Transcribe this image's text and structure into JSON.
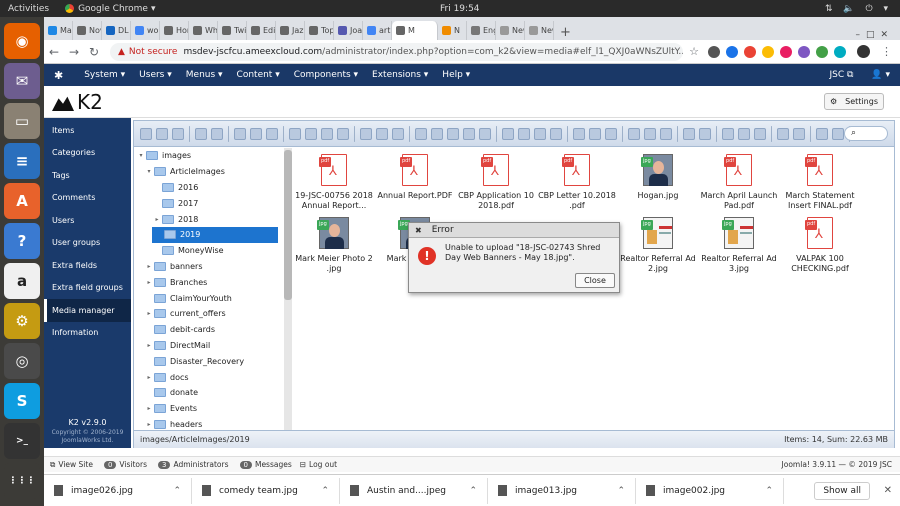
{
  "system": {
    "activities": "Activities",
    "app_name": "Google Chrome",
    "clock": "Fri 19:54"
  },
  "dock": [
    {
      "name": "firefox",
      "glyph": "◉",
      "color": "#e66000"
    },
    {
      "name": "mail",
      "glyph": "✉",
      "color": "#6d5d8f"
    },
    {
      "name": "files",
      "glyph": "▭",
      "color": "#8a8173"
    },
    {
      "name": "writer",
      "glyph": "≡",
      "color": "#2a6fbd"
    },
    {
      "name": "software",
      "glyph": "A",
      "color": "#e8622b"
    },
    {
      "name": "help",
      "glyph": "?",
      "color": "#3a7ad1"
    },
    {
      "name": "amazon",
      "glyph": "a",
      "color": "#f0f0f0"
    },
    {
      "name": "settings",
      "glyph": "⚙",
      "color": "#c59b12"
    },
    {
      "name": "chrome",
      "glyph": "◎",
      "color": "#4a4a4a"
    },
    {
      "name": "skype",
      "glyph": "S",
      "color": "#0e9de0"
    },
    {
      "name": "terminal",
      "glyph": ">_",
      "color": "#333333"
    },
    {
      "name": "apps",
      "glyph": "⋮⋮⋮",
      "color": "#3c3b37"
    }
  ],
  "tabs": [
    {
      "label": "Mai",
      "color": "#1e88e5"
    },
    {
      "label": "Nov",
      "color": "#666666"
    },
    {
      "label": "DL",
      "color": "#1565c0"
    },
    {
      "label": "wor",
      "color": "#4285f4"
    },
    {
      "label": "Hor",
      "color": "#666666"
    },
    {
      "label": "Whe",
      "color": "#666666"
    },
    {
      "label": "Twi",
      "color": "#666666"
    },
    {
      "label": "Edi",
      "color": "#666666"
    },
    {
      "label": "Jaz",
      "color": "#666666"
    },
    {
      "label": "Top",
      "color": "#666666"
    },
    {
      "label": "Joa",
      "color": "#5558af"
    },
    {
      "label": "arti",
      "color": "#4285f4"
    },
    {
      "label": "M",
      "color": "#666666"
    },
    {
      "label": "N",
      "color": "#f08c00"
    },
    {
      "label": "Eng",
      "color": "#777777"
    },
    {
      "label": "New Ta",
      "color": "#999999"
    },
    {
      "label": "New Ta",
      "color": "#999999"
    }
  ],
  "browser": {
    "not_secure": "Not secure",
    "url_host": "msdev-jscfcu.ameexcloud.com",
    "url_path": "/administrator/index.php?option=com_k2&view=media#elf_l1_QXJ0aWNsZUltY..."
  },
  "joomla_menu": [
    "System ▾",
    "Users ▾",
    "Menus ▾",
    "Content ▾",
    "Components ▾",
    "Extensions ▾",
    "Help ▾"
  ],
  "joomla_right": {
    "site": "JSC ⧉",
    "user": "👤 ▾"
  },
  "k2": {
    "logo": "K2",
    "settings": "Settings"
  },
  "sidebar": {
    "items": [
      "Items",
      "Categories",
      "Tags",
      "Comments",
      "Users",
      "User groups",
      "Extra fields",
      "Extra field groups",
      "Media manager",
      "Information"
    ],
    "active_index": 8,
    "version": "K2 v2.9.0",
    "copyright": "Copyright © 2006-2019",
    "company": "JoomlaWorks Ltd."
  },
  "tree": [
    {
      "label": "images",
      "indent": 0,
      "arrow": "▾"
    },
    {
      "label": "ArticleImages",
      "indent": 1,
      "arrow": "▾"
    },
    {
      "label": "2016",
      "indent": 2,
      "arrow": ""
    },
    {
      "label": "2017",
      "indent": 2,
      "arrow": ""
    },
    {
      "label": "2018",
      "indent": 2,
      "arrow": "▸"
    },
    {
      "label": "2019",
      "indent": 2,
      "arrow": "",
      "selected": true
    },
    {
      "label": "MoneyWise",
      "indent": 2,
      "arrow": ""
    },
    {
      "label": "banners",
      "indent": 1,
      "arrow": "▸"
    },
    {
      "label": "Branches",
      "indent": 1,
      "arrow": "▸"
    },
    {
      "label": "ClaimYourYouth",
      "indent": 1,
      "arrow": ""
    },
    {
      "label": "current_offers",
      "indent": 1,
      "arrow": "▸"
    },
    {
      "label": "debit-cards",
      "indent": 1,
      "arrow": ""
    },
    {
      "label": "DirectMail",
      "indent": 1,
      "arrow": "▸"
    },
    {
      "label": "Disaster_Recovery",
      "indent": 1,
      "arrow": ""
    },
    {
      "label": "docs",
      "indent": 1,
      "arrow": "▸"
    },
    {
      "label": "donate",
      "indent": 1,
      "arrow": ""
    },
    {
      "label": "Events",
      "indent": 1,
      "arrow": "▸"
    },
    {
      "label": "headers",
      "indent": 1,
      "arrow": "▸"
    }
  ],
  "files": [
    {
      "name": "19-JSC-00756 2018 Annual Report...",
      "type": "pdf"
    },
    {
      "name": "Annual Report.PDF",
      "type": "pdf"
    },
    {
      "name": "CBP Application 10 2018.pdf",
      "type": "pdf"
    },
    {
      "name": "CBP Letter 10.2018 .pdf",
      "type": "pdf"
    },
    {
      "name": "Hogan.jpg",
      "type": "jpg"
    },
    {
      "name": "March April Launch Pad.pdf",
      "type": "pdf"
    },
    {
      "name": "March Statement Insert FINAL.pdf",
      "type": "pdf"
    },
    {
      "name": "Mark Meier Photo 2 .jpg",
      "type": "jpg"
    },
    {
      "name": "Mark Me 175x",
      "type": "jpg"
    },
    {
      "name": "",
      "type": "hidden"
    },
    {
      "name": "",
      "type": "hidden"
    },
    {
      "name": "Realtor Referral Ad 2.jpg",
      "type": "jpg-white"
    },
    {
      "name": "Realtor Referral Ad 3.jpg",
      "type": "jpg-white"
    },
    {
      "name": "VALPAK 100 CHECKING.pdf",
      "type": "pdf"
    }
  ],
  "fm_status": {
    "path": "images/ArticleImages/2019",
    "summary": "Items: 14, Sum: 22.63 MB"
  },
  "search_icon": "⌕",
  "dialog": {
    "title": "Error",
    "close": "✖",
    "message": "Unable to upload \"18-JSC-02743 Shred Day Web Banners - May 18.jpg\".",
    "button": "Close"
  },
  "footer": {
    "view_site": "View Site",
    "visitors_count": "0",
    "visitors": "Visitors",
    "admins_count": "3",
    "admins": "Administrators",
    "messages_count": "0",
    "messages": "Messages",
    "logout": "Log out",
    "right": "Joomla! 3.9.11 — © 2019 JSC"
  },
  "downloads": {
    "items": [
      "image026.jpg",
      "comedy team.jpg",
      "Austin and....jpeg",
      "image013.jpg",
      "image002.jpg"
    ],
    "show_all": "Show all"
  }
}
